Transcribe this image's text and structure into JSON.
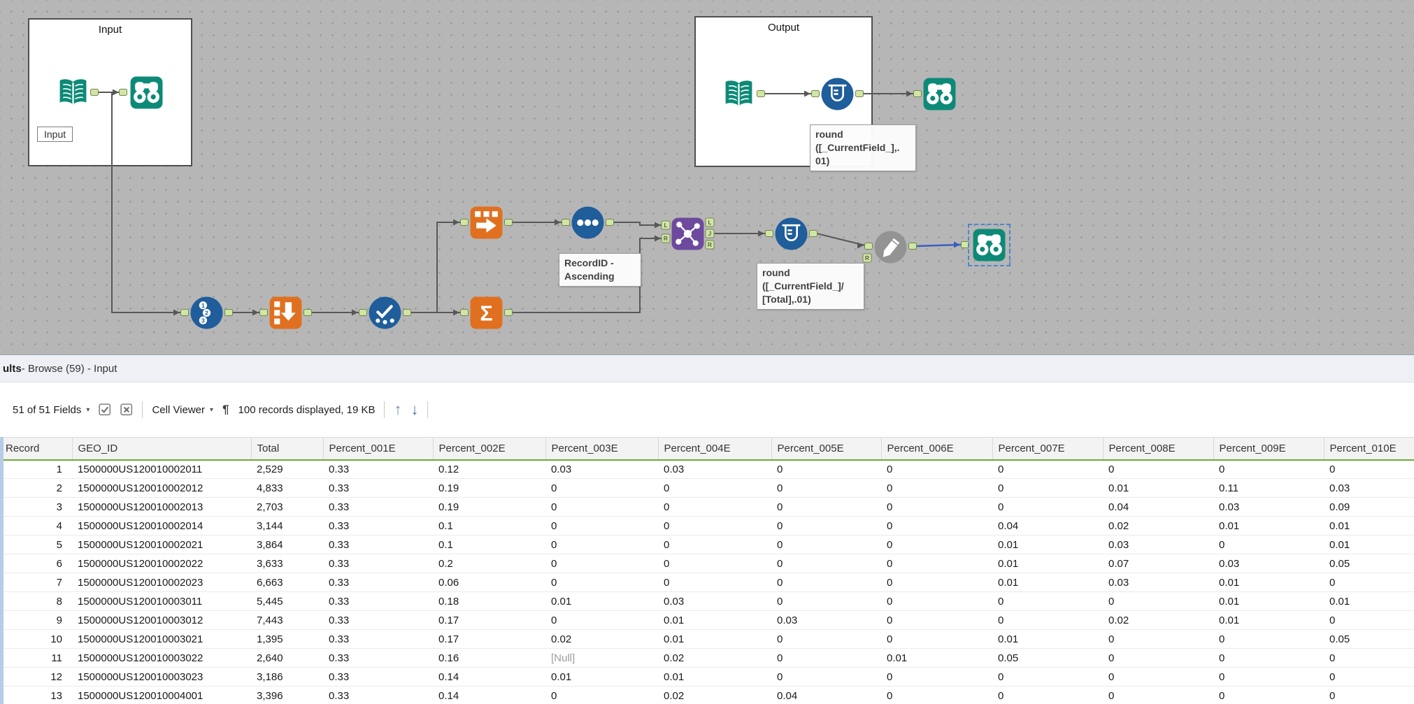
{
  "colors": {
    "teal": "#0d8a77",
    "orange": "#e0701f",
    "blue": "#1f5d9b",
    "purple": "#6d4a9e",
    "gray_tool": "#939393",
    "selected_connection": "#3a5fc0",
    "connection": "#585858",
    "anchor_fill": "#cfe6a5",
    "anchor_stroke": "#76854d",
    "header_underline_green": "#6fa83c",
    "canvas_background": "#b6b6b6"
  },
  "canvas": {
    "input_container_label": "Input",
    "output_container_label": "Output",
    "input_ghost_label": "Input",
    "annotation_output": "round\n([_CurrentField_],.\n01)",
    "annotation_sort": "RecordID -\nAscending",
    "annotation_formula": "round\n([_CurrentField_]/\n[Total],.01)",
    "join_labels": [
      "L",
      "J",
      "R"
    ]
  },
  "results": {
    "titlebar": {
      "prefix": "ults",
      "rest": " - Browse (59) - Input"
    },
    "toolbar": {
      "fields": "51 of 51 Fields",
      "cell_viewer": "Cell Viewer",
      "records": "100 records displayed, 19 KB"
    },
    "table": {
      "columns": [
        "Record",
        "GEO_ID",
        "Total",
        "Percent_001E",
        "Percent_002E",
        "Percent_003E",
        "Percent_004E",
        "Percent_005E",
        "Percent_006E",
        "Percent_007E",
        "Percent_008E",
        "Percent_009E",
        "Percent_010E"
      ],
      "rows": [
        [
          "1",
          "1500000US120010002011",
          "2,529",
          "0.33",
          "0.12",
          "0.03",
          "0.03",
          "0",
          "0",
          "0",
          "0",
          "0",
          "0"
        ],
        [
          "2",
          "1500000US120010002012",
          "4,833",
          "0.33",
          "0.19",
          "0",
          "0",
          "0",
          "0",
          "0",
          "0.01",
          "0.11",
          "0.03"
        ],
        [
          "3",
          "1500000US120010002013",
          "2,703",
          "0.33",
          "0.19",
          "0",
          "0",
          "0",
          "0",
          "0",
          "0.04",
          "0.03",
          "0.09"
        ],
        [
          "4",
          "1500000US120010002014",
          "3,144",
          "0.33",
          "0.1",
          "0",
          "0",
          "0",
          "0",
          "0.04",
          "0.02",
          "0.01",
          "0.01"
        ],
        [
          "5",
          "1500000US120010002021",
          "3,864",
          "0.33",
          "0.1",
          "0",
          "0",
          "0",
          "0",
          "0.01",
          "0.03",
          "0",
          "0.01"
        ],
        [
          "6",
          "1500000US120010002022",
          "3,633",
          "0.33",
          "0.2",
          "0",
          "0",
          "0",
          "0",
          "0.01",
          "0.07",
          "0.03",
          "0.05"
        ],
        [
          "7",
          "1500000US120010002023",
          "6,663",
          "0.33",
          "0.06",
          "0",
          "0",
          "0",
          "0",
          "0.01",
          "0.03",
          "0.01",
          "0"
        ],
        [
          "8",
          "1500000US120010003011",
          "5,445",
          "0.33",
          "0.18",
          "0.01",
          "0.03",
          "0",
          "0",
          "0",
          "0",
          "0.01",
          "0.01"
        ],
        [
          "9",
          "1500000US120010003012",
          "7,443",
          "0.33",
          "0.17",
          "0",
          "0.01",
          "0.03",
          "0",
          "0",
          "0.02",
          "0.01",
          "0"
        ],
        [
          "10",
          "1500000US120010003021",
          "1,395",
          "0.33",
          "0.17",
          "0.02",
          "0.01",
          "0",
          "0",
          "0.01",
          "0",
          "0",
          "0.05"
        ],
        [
          "11",
          "1500000US120010003022",
          "2,640",
          "0.33",
          "0.16",
          "[Null]",
          "0.02",
          "0",
          "0.01",
          "0.05",
          "0",
          "0",
          "0"
        ],
        [
          "12",
          "1500000US120010003023",
          "3,186",
          "0.33",
          "0.14",
          "0.01",
          "0.01",
          "0",
          "0",
          "0",
          "0",
          "0",
          "0"
        ],
        [
          "13",
          "1500000US120010004001",
          "3,396",
          "0.33",
          "0.14",
          "0",
          "0.02",
          "0.04",
          "0",
          "0",
          "0",
          "0",
          "0"
        ]
      ]
    }
  }
}
